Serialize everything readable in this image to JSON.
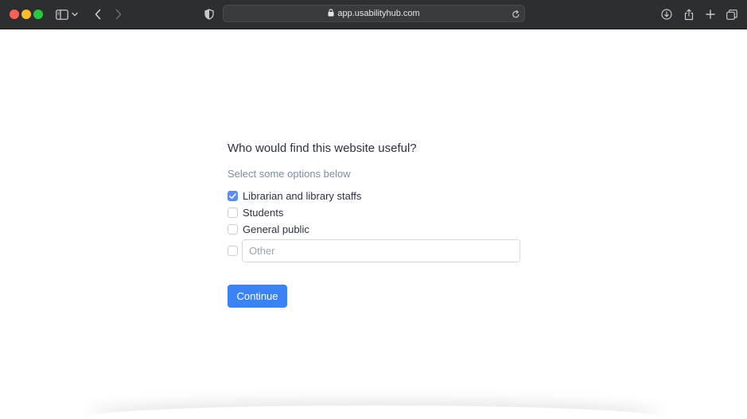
{
  "browser": {
    "url": "app.usabilityhub.com",
    "icons": [
      "sidebar-icon",
      "chevron-down-icon",
      "back-icon",
      "forward-icon",
      "shield-icon",
      "lock-icon",
      "reload-icon",
      "download-icon",
      "share-icon",
      "new-tab-icon",
      "tab-overview-icon"
    ]
  },
  "survey": {
    "question": "Who would find this website useful?",
    "hint": "Select some options below",
    "options": [
      {
        "label": "Librarian and library staffs",
        "checked": true
      },
      {
        "label": "Students",
        "checked": false
      },
      {
        "label": "General public",
        "checked": false
      }
    ],
    "other": {
      "placeholder": "Other",
      "checked": false
    },
    "continue_label": "Continue"
  },
  "colors": {
    "accent": "#3b82f6",
    "checkbox_checked": "#5b8def",
    "toolbar": "#2d2e30"
  }
}
